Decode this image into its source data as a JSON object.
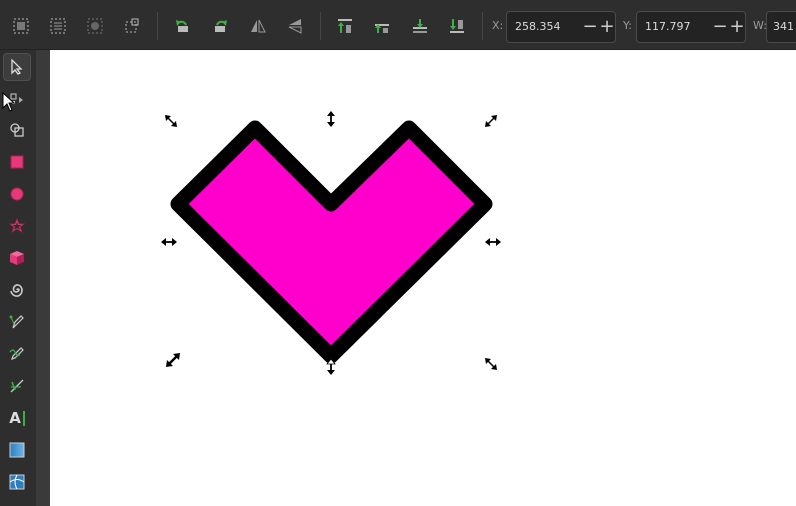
{
  "toolbar": {
    "x_label": "X:",
    "x_value": "258.354",
    "y_label": "Y:",
    "y_value": "117.797",
    "w_label": "W:",
    "w_value": "341",
    "minus": "−",
    "plus": "+"
  },
  "tools": [
    {
      "name": "selector-tool",
      "icon": "arrow-pointer-icon"
    },
    {
      "name": "node-tool",
      "icon": "node-edit-icon"
    },
    {
      "name": "tweak-tool",
      "icon": "shape-builder-icon"
    },
    {
      "name": "rectangle-tool",
      "icon": "rectangle-icon"
    },
    {
      "name": "ellipse-tool",
      "icon": "circle-icon"
    },
    {
      "name": "star-tool",
      "icon": "star-icon"
    },
    {
      "name": "3d-box-tool",
      "icon": "cube-icon"
    },
    {
      "name": "spiral-tool",
      "icon": "spiral-icon"
    },
    {
      "name": "pen-tool",
      "icon": "pen-icon"
    },
    {
      "name": "pencil-tool",
      "icon": "pencil-icon"
    },
    {
      "name": "calligraphy-tool",
      "icon": "calligraphy-icon"
    },
    {
      "name": "text-tool",
      "icon": "text-icon"
    },
    {
      "name": "gradient-tool",
      "icon": "gradient-icon"
    },
    {
      "name": "mesh-tool",
      "icon": "mesh-icon"
    }
  ],
  "text_tool_glyph": "A",
  "colors": {
    "shape_fill": "#ff00cc",
    "shape_stroke": "#000000",
    "accent_green": "#3cb043",
    "tool_pink": "#e6397a"
  }
}
